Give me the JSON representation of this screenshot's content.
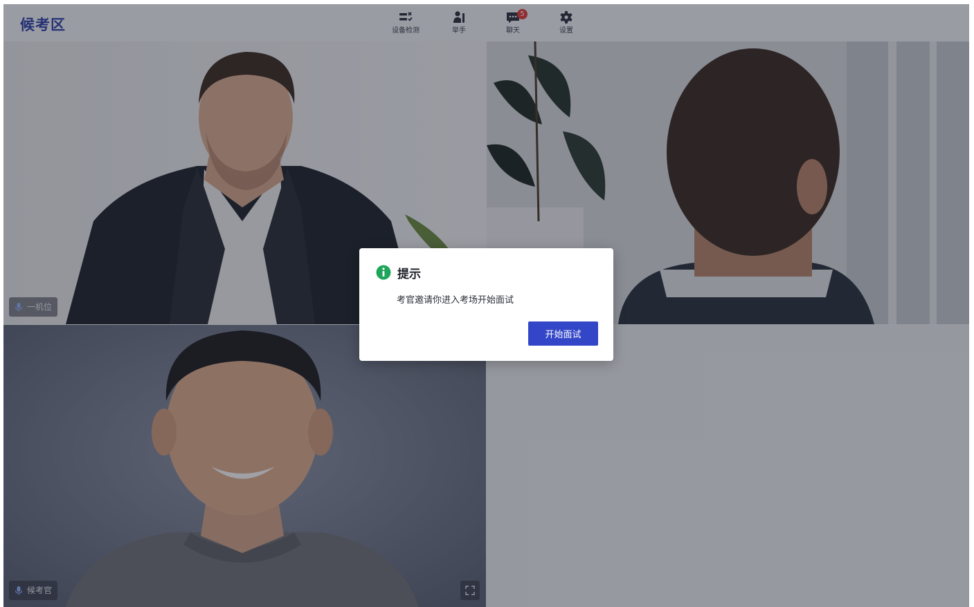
{
  "app": {
    "title": "候考区"
  },
  "toolbar": {
    "device_check": {
      "label": "设备检测",
      "icon": "device-check-icon"
    },
    "raise_hand": {
      "label": "举手",
      "icon": "raise-hand-icon"
    },
    "chat": {
      "label": "聊天",
      "icon": "chat-icon",
      "unread": "5"
    },
    "settings": {
      "label": "设置",
      "icon": "gear-icon"
    }
  },
  "videos": {
    "top_left": {
      "name": "一机位"
    },
    "bottom_left": {
      "name": "候考官"
    }
  },
  "dialog": {
    "title": "提示",
    "message": "考官邀请你进入考场开始面试",
    "confirm_label": "开始面试"
  },
  "colors": {
    "brand": "#2b3fa8",
    "primary_button": "#3346c8",
    "info_green": "#1fa55a",
    "badge_red": "#e53935"
  }
}
